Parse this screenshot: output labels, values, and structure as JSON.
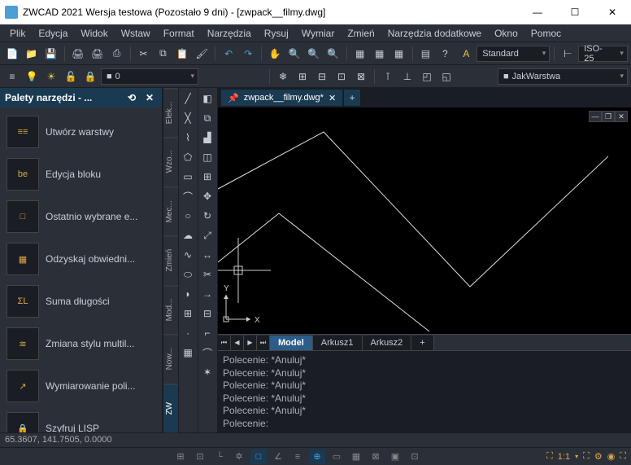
{
  "titlebar": {
    "text": "ZWCAD 2021 Wersja testowa (Pozostało 9 dni) - [zwpack__filmy.dwg]"
  },
  "menu": [
    "Plik",
    "Edycja",
    "Widok",
    "Wstaw",
    "Format",
    "Narzędzia",
    "Rysuj",
    "Wymiar",
    "Zmień",
    "Narzędzia dodatkowe",
    "Okno",
    "Pomoc"
  ],
  "toolbar1": {
    "style_label": "Standard",
    "dim_style": "ISO-25"
  },
  "toolbar2": {
    "layer": "0",
    "layer_style": "JakWarstwa"
  },
  "palette": {
    "title": "Palety narzędzi - ...",
    "items": [
      {
        "icon": "≡≡",
        "label": "Utwórz warstwy"
      },
      {
        "icon": "be",
        "label": "Edycja bloku"
      },
      {
        "icon": "□",
        "label": "Ostatnio wybrane e..."
      },
      {
        "icon": "▦",
        "label": "Odzyskaj obwiedni..."
      },
      {
        "icon": "ΣL",
        "label": "Suma długości"
      },
      {
        "icon": "≋",
        "label": "Zmiana stylu multil..."
      },
      {
        "icon": "↗",
        "label": "Wymiarowanie poli..."
      },
      {
        "icon": "🔒",
        "label": "Szyfruj LISP"
      }
    ]
  },
  "vtabs": [
    "ZW",
    "Now...",
    "Mod...",
    "Zmień",
    "Mec...",
    "Wzo...",
    "Elek..."
  ],
  "doc": {
    "name": "zwpack__filmy.dwg*"
  },
  "model_tabs": [
    "Model",
    "Arkusz1",
    "Arkusz2"
  ],
  "cmd": {
    "history": [
      "Polecenie: *Anuluj*",
      "Polecenie: *Anuluj*",
      "Polecenie: *Anuluj*",
      "Polecenie: *Anuluj*",
      "Polecenie: *Anuluj*"
    ],
    "prompt": "Polecenie:"
  },
  "status": {
    "coords": "65.3607, 141.7505, 0.0000",
    "scale": "1:1"
  },
  "ucs": {
    "x": "X",
    "y": "Y"
  }
}
